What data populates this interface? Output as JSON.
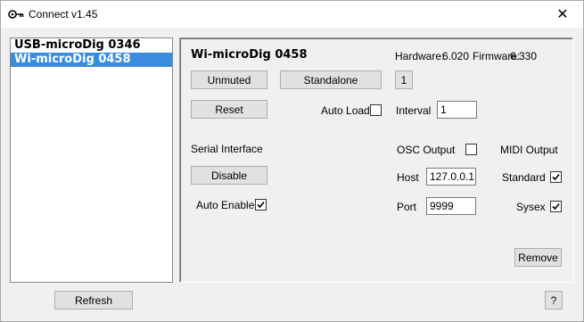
{
  "window": {
    "title": "Connect v1.45",
    "close_glyph": "✕",
    "icon": "key-icon"
  },
  "devices": [
    {
      "label": "USB-microDig 0346",
      "selected": false
    },
    {
      "label": "Wi-microDig 0458",
      "selected": true
    }
  ],
  "detail": {
    "device_name": "Wi-microDig 0458",
    "hardware_label": "Hardware:",
    "hardware_value": "6.020",
    "firmware_label": "Firmware:",
    "firmware_value": "6.330",
    "unmuted_label": "Unmuted",
    "standalone_label": "Standalone",
    "number_button_label": "1",
    "reset_label": "Reset",
    "auto_load_label": "Auto Load",
    "auto_load_checked": false,
    "interval_label": "Interval",
    "interval_value": "1",
    "serial_interface_label": "Serial Interface",
    "disable_label": "Disable",
    "auto_enable_label": "Auto Enable",
    "auto_enable_checked": true,
    "osc_output_label": "OSC Output",
    "osc_output_checked": false,
    "midi_output_label": "MIDI Output",
    "host_label": "Host",
    "host_value": "127.0.0.1",
    "port_label": "Port",
    "port_value": "9999",
    "standard_label": "Standard",
    "standard_checked": true,
    "sysex_label": "Sysex",
    "sysex_checked": true,
    "remove_label": "Remove"
  },
  "footer": {
    "refresh_label": "Refresh",
    "help_label": "?"
  }
}
